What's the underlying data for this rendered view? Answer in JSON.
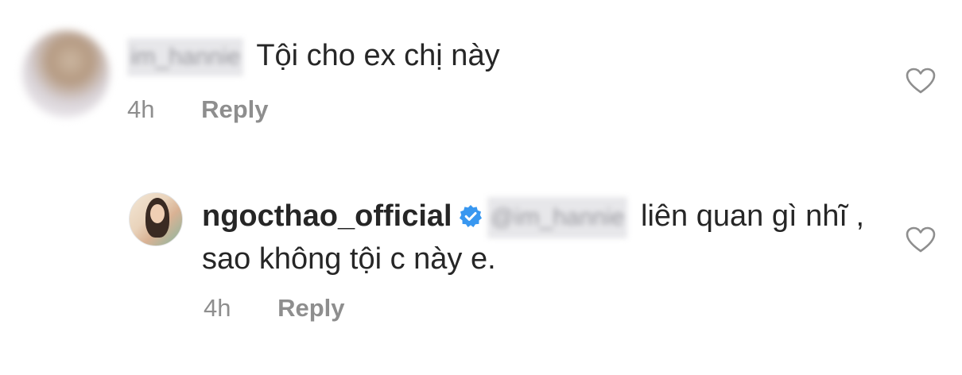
{
  "comment1": {
    "username": "im_hannie",
    "text": "Tội cho ex chị này",
    "time": "4h",
    "reply_label": "Reply",
    "avatar_icon": "user-avatar-blurred"
  },
  "comment2": {
    "username": "ngocthao_official",
    "verified_icon": "verified-badge-icon",
    "mention": "@im_hannie",
    "text": "liên quan gì nhĩ , sao không tội c này e.",
    "time": "4h",
    "reply_label": "Reply",
    "avatar_icon": "user-avatar-photo"
  },
  "colors": {
    "text": "#262626",
    "meta": "#8e8e8e",
    "verified": "#3897f0",
    "heart_stroke": "#8e8e8e"
  },
  "icons": {
    "like": "heart-outline-icon"
  }
}
